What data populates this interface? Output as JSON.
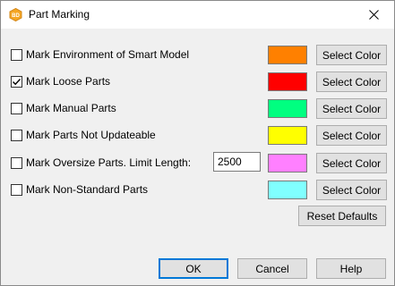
{
  "window": {
    "title": "Part Marking",
    "app_icon": "app-logo-icon",
    "close_icon": "close-icon"
  },
  "options": [
    {
      "label": "Mark Environment of Smart Model",
      "checked": false,
      "color": "#ff8000",
      "button": "Select Color"
    },
    {
      "label": "Mark Loose Parts",
      "checked": true,
      "color": "#ff0000",
      "button": "Select Color"
    },
    {
      "label": "Mark Manual Parts",
      "checked": false,
      "color": "#00ff80",
      "button": "Select Color"
    },
    {
      "label": "Mark Parts Not Updateable",
      "checked": false,
      "color": "#ffff00",
      "button": "Select Color"
    },
    {
      "label": "Mark Oversize Parts. Limit Length:",
      "checked": false,
      "color": "#ff80ff",
      "button": "Select Color",
      "limit_value": "2500"
    },
    {
      "label": "Mark Non-Standard Parts",
      "checked": false,
      "color": "#80ffff",
      "button": "Select Color"
    }
  ],
  "reset_button": "Reset Defaults",
  "footer": {
    "ok": "OK",
    "cancel": "Cancel",
    "help": "Help"
  }
}
